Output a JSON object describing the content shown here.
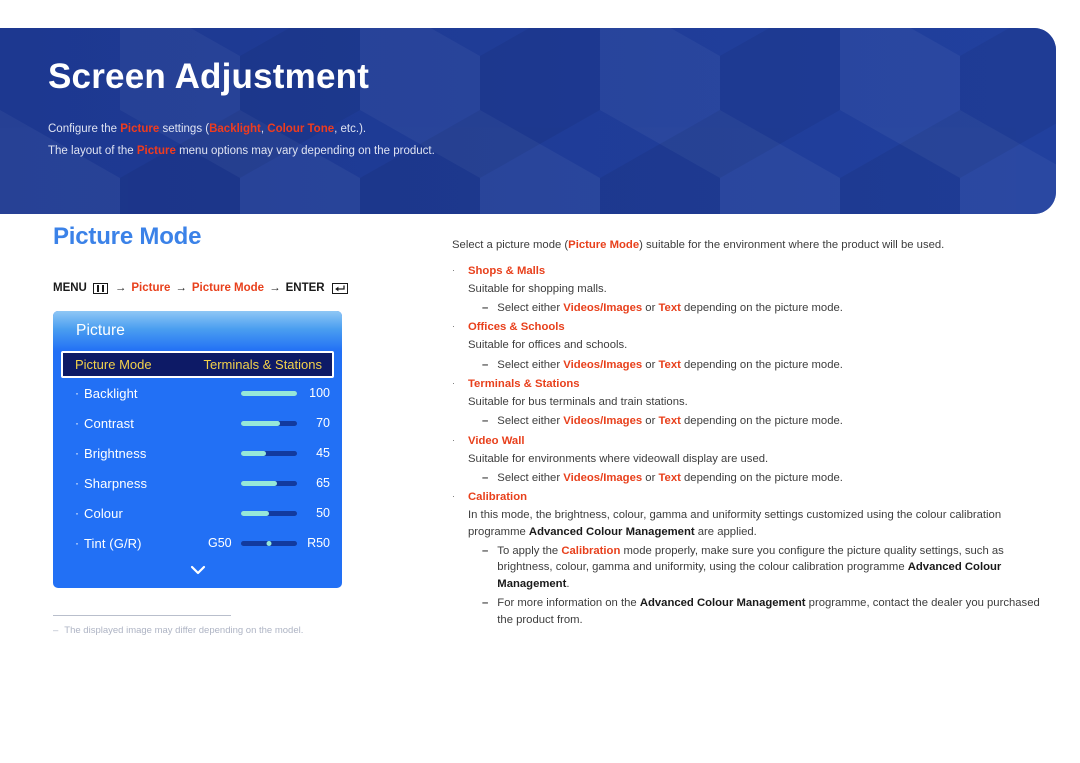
{
  "banner": {
    "title": "Screen Adjustment",
    "line1": {
      "p1": "Configure the ",
      "hl1": "Picture",
      "p2": " settings (",
      "hl2": "Backlight",
      "p3": ", ",
      "hl3": "Colour Tone",
      "p4": ", etc.)."
    },
    "line2": {
      "p1": "The layout of the ",
      "hl1": "Picture",
      "p2": " menu options may vary depending on the product."
    },
    "bg_color": "#1f3c96",
    "highlight_color": "#f03c1e"
  },
  "section": {
    "title": "Picture Mode",
    "title_color": "#3b82e8"
  },
  "menu_path": {
    "menu_label": "MENU",
    "menu_icon": "menu-grid-icon",
    "arrow": "→",
    "step1": "Picture",
    "step2": "Picture Mode",
    "enter_label": "ENTER",
    "enter_icon": "enter-return-icon"
  },
  "osd": {
    "header": "Picture",
    "selected": {
      "name": "Picture Mode",
      "value": "Terminals & Stations"
    },
    "rows": [
      {
        "label": "Backlight",
        "value": "100",
        "percent": 100,
        "type": "slider"
      },
      {
        "label": "Contrast",
        "value": "70",
        "percent": 70,
        "type": "slider"
      },
      {
        "label": "Brightness",
        "value": "45",
        "percent": 45,
        "type": "slider"
      },
      {
        "label": "Sharpness",
        "value": "65",
        "percent": 65,
        "type": "slider"
      },
      {
        "label": "Colour",
        "value": "50",
        "percent": 50,
        "type": "slider"
      },
      {
        "label": "Tint (G/R)",
        "left": "G50",
        "right": "R50",
        "type": "tint"
      }
    ],
    "more_icon": "chevron-down-icon",
    "fill_color": "#96e8d8",
    "track_color": "#123a9e",
    "panel_color": "#2270f5",
    "selected_text_color": "#f3d14b"
  },
  "footnote": {
    "dash": "–",
    "text": "The displayed image may differ depending on the model."
  },
  "main": {
    "intro": {
      "p1": "Select a picture mode (",
      "b1": "Picture Mode",
      "p2": ") suitable for the environment where the product will be used."
    },
    "bullet_char": "·",
    "dash_char": "–",
    "items": [
      {
        "title": "Shops & Malls",
        "desc": "Suitable for shopping malls.",
        "sub": [
          {
            "a": "Select either ",
            "b1": "Videos/Images",
            "c": " or ",
            "b2": "Text",
            "d": " depending on the picture mode."
          }
        ]
      },
      {
        "title": "Offices & Schools",
        "desc": "Suitable for offices and schools.",
        "sub": [
          {
            "a": "Select either ",
            "b1": "Videos/Images",
            "c": " or ",
            "b2": "Text",
            "d": " depending on the picture mode."
          }
        ]
      },
      {
        "title": "Terminals & Stations",
        "desc": "Suitable for bus terminals and train stations.",
        "sub": [
          {
            "a": "Select either ",
            "b1": "Videos/Images",
            "c": " or ",
            "b2": "Text",
            "d": " depending on the picture mode."
          }
        ]
      },
      {
        "title": "Video Wall",
        "desc": "Suitable for environments where videowall display are used.",
        "sub": [
          {
            "a": "Select either ",
            "b1": "Videos/Images",
            "c": " or ",
            "b2": "Text",
            "d": " depending on the picture mode."
          }
        ]
      }
    ],
    "calibration": {
      "title": "Calibration",
      "desc_p1": "In this mode, the brightness, colour, gamma and uniformity settings customized using the colour calibration programme ",
      "desc_b1": "Advanced Colour Management",
      "desc_p2": " are applied.",
      "sub1_a": "To apply the ",
      "sub1_red": "Calibration",
      "sub1_b": " mode properly, make sure you configure the picture quality settings, such as brightness, colour, gamma and uniformity, using the colour calibration programme ",
      "sub1_blk": "Advanced Colour Management",
      "sub1_c": ".",
      "sub2_a": "For more information on the ",
      "sub2_blk": "Advanced Colour Management",
      "sub2_b": " programme, contact the dealer you purchased the product from."
    }
  }
}
